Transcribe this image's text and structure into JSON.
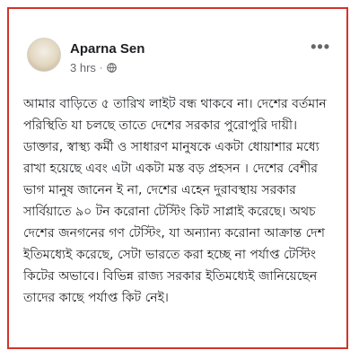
{
  "post": {
    "author": "Aparna Sen",
    "time": "3 hrs",
    "separator": "·",
    "privacy_icon": "globe-icon",
    "more_label": "•••",
    "body": "আমার বাড়িতে ৫ তারিখ লাইট বন্ধ থাকবে না। দেশের বর্তমান পরিস্থিতি যা চলছে তাতে দেশের সরকার পুরোপুরি দায়ী। ডাক্তার, স্বাস্থ্য কর্মী ও সাধারণ মানুষকে একটা ধোয়াশার মধ্যে রাখা হয়েছে এবং এটা একটা মস্ত বড় প্রহসন । দেশের বেশীর ভাগ মানুষ জানেন ই না, দেশের এহেন দুরাবস্থায় সরকার সার্বিয়াতে ৯০ টন করোনা টেস্টিং কিট সাপ্লাই করেছে। অথচ দেশের জনগনের গণ টেস্টিং, যা অন্যান্য করোনা আক্রান্ত দেশ ইতিমধ্যেই করেছে, সেটা ভারতে করা হচ্ছে না পর্যাপ্ত টেস্টিং কিটের অভাবে। বিভিন্ন রাজ্য সরকার ইতিমধ্যেই জানিয়েছেন তাদের কাছে পর্যাপ্ত কিট নেই।"
  },
  "colors": {
    "frame_border": "#d0342c",
    "text": "#1c1e21",
    "secondary_text": "#65676b"
  }
}
